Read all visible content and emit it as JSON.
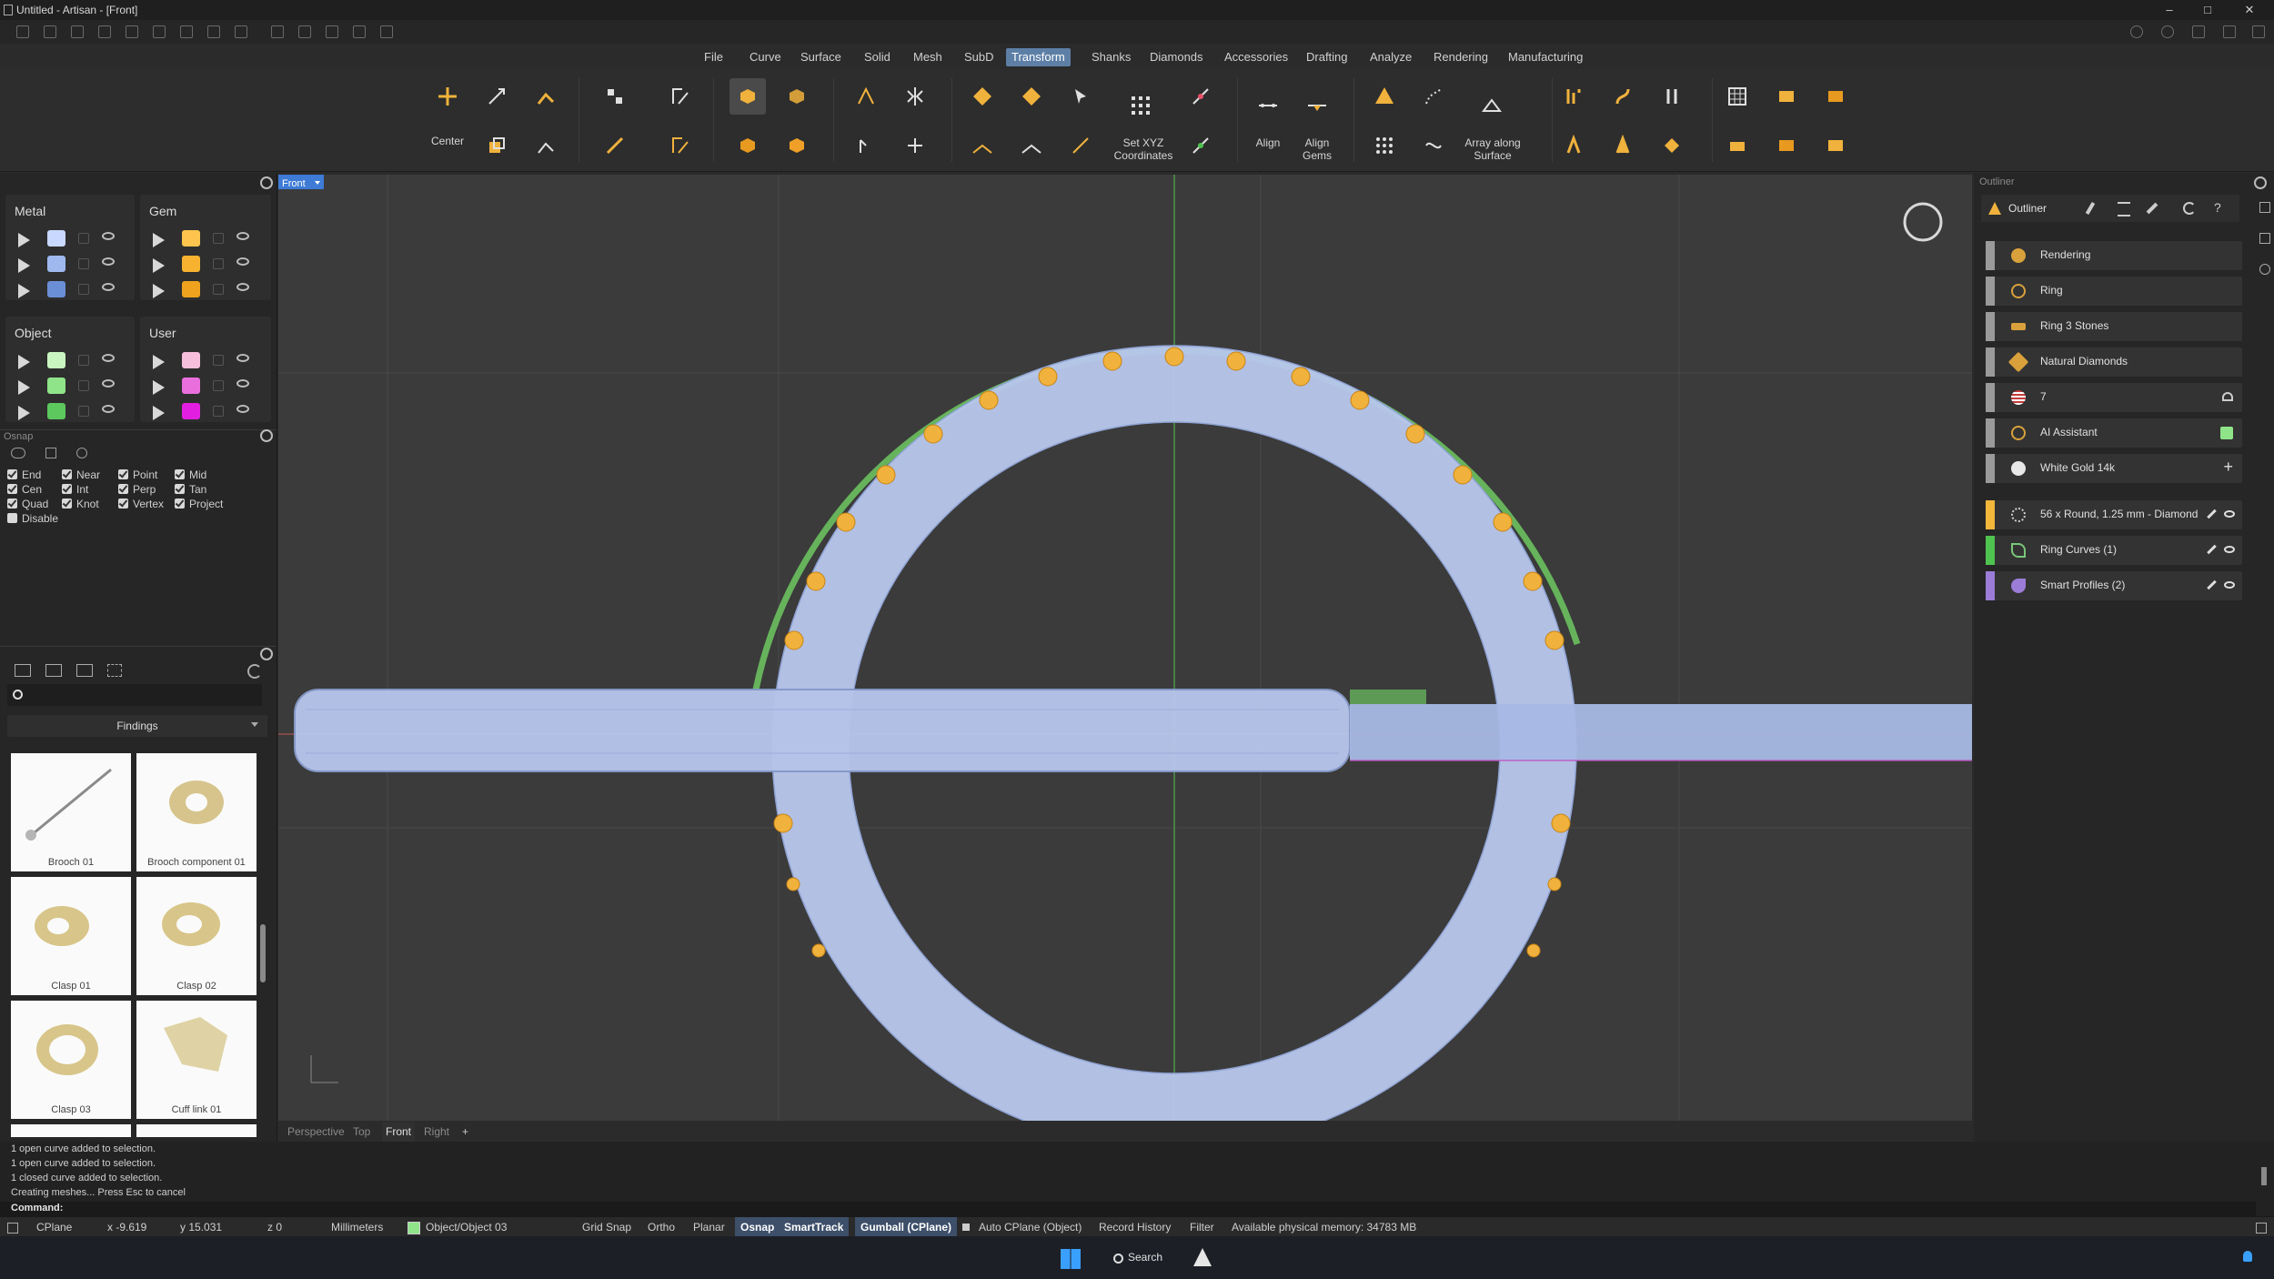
{
  "window": {
    "title": "Untitled - Artisan - [Front]",
    "controls": [
      "–",
      "□",
      "✕"
    ]
  },
  "menu": [
    "File",
    "Curve",
    "Surface",
    "Solid",
    "Mesh",
    "SubD",
    "Transform",
    "Shanks",
    "Diamonds",
    "Accessories",
    "Drafting",
    "Analyze",
    "Rendering",
    "Manufacturing"
  ],
  "menu_active": "Transform",
  "toolbar": {
    "center": "Center",
    "set_xyz": "Set XYZ Coordinates",
    "align": "Align",
    "align_gems": "Align Gems",
    "array_along_surface": "Array along Surface"
  },
  "layers": {
    "metal": "Metal",
    "gem": "Gem",
    "object": "Object",
    "user": "User",
    "metal_colors": [
      "#c9d8ff",
      "#9fb9ef",
      "#6b8fd6"
    ],
    "gem_colors": [
      "#ffc44d",
      "#f7b330",
      "#eea21d"
    ],
    "object_colors": [
      "#c8f5c0",
      "#8fe48a",
      "#5cc85e"
    ],
    "user_colors": [
      "#f7bfdc",
      "#e86fdc",
      "#e21fe0"
    ]
  },
  "osnap": {
    "title": "Osnap",
    "items": [
      {
        "label": "End",
        "on": true
      },
      {
        "label": "Near",
        "on": true
      },
      {
        "label": "Point",
        "on": true
      },
      {
        "label": "Mid",
        "on": true
      },
      {
        "label": "Cen",
        "on": true
      },
      {
        "label": "Int",
        "on": true
      },
      {
        "label": "Perp",
        "on": true
      },
      {
        "label": "Tan",
        "on": true
      },
      {
        "label": "Quad",
        "on": true
      },
      {
        "label": "Knot",
        "on": true
      },
      {
        "label": "Vertex",
        "on": true
      },
      {
        "label": "Project",
        "on": true
      },
      {
        "label": "Disable",
        "on": false
      }
    ]
  },
  "library": {
    "search_placeholder": "",
    "category": "Findings",
    "items": [
      "Brooch 01",
      "Brooch component 01",
      "Clasp 01",
      "Clasp 02",
      "Clasp 03",
      "Cuff link 01"
    ]
  },
  "viewport": {
    "active_label": "Front",
    "tabs": [
      "Perspective",
      "Top",
      "Front",
      "Right",
      "+"
    ]
  },
  "outliner": {
    "title": "Outliner",
    "rows": [
      {
        "label": "Rendering",
        "bar": "#9a9a9a",
        "icon": "#d9a13b"
      },
      {
        "label": "Ring",
        "bar": "#9a9a9a",
        "icon": "#d9a13b"
      },
      {
        "label": "Ring 3 Stones",
        "bar": "#9a9a9a",
        "icon": "#d9a13b"
      },
      {
        "label": "Natural Diamonds",
        "bar": "#9a9a9a",
        "icon": "#d9a13b"
      },
      {
        "label": "7",
        "bar": "#9a9a9a",
        "icon": "#c23b3b"
      },
      {
        "label": "AI Assistant",
        "bar": "#9a9a9a",
        "icon": "#d9a13b"
      },
      {
        "label": "White Gold 14k",
        "bar": "#9a9a9a",
        "icon": "#e8e8e8"
      },
      {
        "label": "56 x Round, 1.25 mm - Diamond",
        "bar": "#f2b63a",
        "icon": "#cfcfcf"
      },
      {
        "label": "Ring Curves (1)",
        "bar": "#4fc34f",
        "icon": "#7ac67a"
      },
      {
        "label": "Smart Profiles (2)",
        "bar": "#9b7cd6",
        "icon": "#9b7cd6"
      }
    ]
  },
  "command": {
    "history": [
      "1 open curve added to selection.",
      "1 open curve added to selection.",
      "1 closed curve added to selection.",
      "Creating meshes... Press Esc to cancel"
    ],
    "prompt": "Command:"
  },
  "status": {
    "cplane": "CPlane",
    "x": "x -9.619",
    "y": "y 15.031",
    "z": "z 0",
    "units": "Millimeters",
    "layer": "Object/Object 03",
    "grid_snap": "Grid Snap",
    "ortho": "Ortho",
    "planar": "Planar",
    "osnap": "Osnap",
    "smarttrack": "SmartTrack",
    "gumball": "Gumball (CPlane)",
    "auto_cplane": "Auto CPlane (Object)",
    "record_history": "Record History",
    "filter": "Filter",
    "memory": "Available physical memory: 34783 MB"
  },
  "taskbar": {
    "search": "Search"
  }
}
